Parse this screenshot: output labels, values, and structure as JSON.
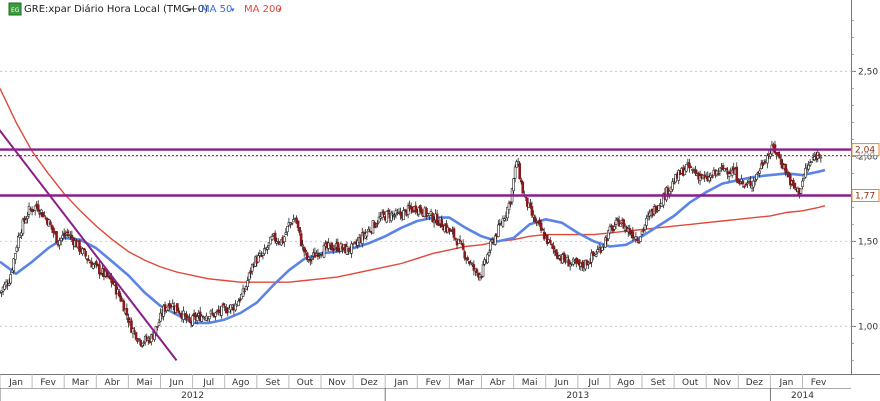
{
  "legend": {
    "symbol_label": "GRE:xpar Diário Hora Local (TMG+0)",
    "ma50_label": "MA 50",
    "ma200_label": "MA 200"
  },
  "colors": {
    "background": "#ffffff",
    "up_candle": "#ffffff",
    "down_candle": "#8b1a1a",
    "wick": "#222222",
    "ma50": "#5b84e6",
    "ma200": "#e0483a",
    "purple": "#8a1f8a",
    "dotted_red": "#d02020",
    "grid": "#c9c9c9",
    "price_badge_border": "#e08a2a"
  },
  "chart_data": {
    "type": "candlestick",
    "title": "GRE:xpar Diário Hora Local (TMG+0)",
    "y_ticks": [
      "1,00",
      "1,50",
      "2,00",
      "2,50"
    ],
    "ylim": [
      0.72,
      2.92
    ],
    "x_months": [
      {
        "label": "Jan",
        "t": 0
      },
      {
        "label": "Fev",
        "t": 1
      },
      {
        "label": "Mar",
        "t": 2
      },
      {
        "label": "Abr",
        "t": 3
      },
      {
        "label": "Mai",
        "t": 4
      },
      {
        "label": "Jun",
        "t": 5
      },
      {
        "label": "Jul",
        "t": 6
      },
      {
        "label": "Ago",
        "t": 7
      },
      {
        "label": "Set",
        "t": 8
      },
      {
        "label": "Out",
        "t": 9
      },
      {
        "label": "Nov",
        "t": 10
      },
      {
        "label": "Dez",
        "t": 11
      },
      {
        "label": "Jan",
        "t": 12
      },
      {
        "label": "Fev",
        "t": 13
      },
      {
        "label": "Mar",
        "t": 14
      },
      {
        "label": "Abr",
        "t": 15
      },
      {
        "label": "Mai",
        "t": 16
      },
      {
        "label": "Jun",
        "t": 17
      },
      {
        "label": "Jul",
        "t": 18
      },
      {
        "label": "Ago",
        "t": 19
      },
      {
        "label": "Set",
        "t": 20
      },
      {
        "label": "Out",
        "t": 21
      },
      {
        "label": "Nov",
        "t": 22
      },
      {
        "label": "Dez",
        "t": 23
      },
      {
        "label": "Jan",
        "t": 24
      },
      {
        "label": "Fev",
        "t": 25
      }
    ],
    "years": [
      {
        "label": "2012",
        "start": 0,
        "end": 12
      },
      {
        "label": "2013",
        "start": 12,
        "end": 24
      },
      {
        "label": "2014",
        "start": 24,
        "end": 26
      }
    ],
    "price_anchors": [
      [
        0.0,
        1.2
      ],
      [
        0.3,
        1.28
      ],
      [
        0.6,
        1.55
      ],
      [
        0.9,
        1.68
      ],
      [
        1.15,
        1.71
      ],
      [
        1.5,
        1.62
      ],
      [
        1.8,
        1.5
      ],
      [
        2.1,
        1.55
      ],
      [
        2.4,
        1.48
      ],
      [
        2.8,
        1.38
      ],
      [
        3.1,
        1.33
      ],
      [
        3.5,
        1.26
      ],
      [
        3.8,
        1.15
      ],
      [
        4.1,
        0.99
      ],
      [
        4.4,
        0.91
      ],
      [
        4.7,
        0.93
      ],
      [
        4.9,
        1.0
      ],
      [
        5.1,
        1.1
      ],
      [
        5.3,
        1.14
      ],
      [
        5.6,
        1.09
      ],
      [
        5.9,
        1.02
      ],
      [
        6.1,
        1.05
      ],
      [
        6.4,
        1.07
      ],
      [
        6.7,
        1.07
      ],
      [
        7.0,
        1.1
      ],
      [
        7.3,
        1.12
      ],
      [
        7.6,
        1.2
      ],
      [
        7.9,
        1.38
      ],
      [
        8.2,
        1.42
      ],
      [
        8.5,
        1.52
      ],
      [
        8.8,
        1.5
      ],
      [
        9.0,
        1.6
      ],
      [
        9.2,
        1.64
      ],
      [
        9.4,
        1.48
      ],
      [
        9.6,
        1.38
      ],
      [
        9.9,
        1.44
      ],
      [
        10.2,
        1.46
      ],
      [
        10.5,
        1.47
      ],
      [
        10.8,
        1.45
      ],
      [
        11.0,
        1.46
      ],
      [
        11.2,
        1.51
      ],
      [
        11.5,
        1.57
      ],
      [
        11.8,
        1.63
      ],
      [
        12.1,
        1.66
      ],
      [
        12.4,
        1.65
      ],
      [
        12.7,
        1.68
      ],
      [
        13.0,
        1.7
      ],
      [
        13.3,
        1.66
      ],
      [
        13.6,
        1.63
      ],
      [
        13.9,
        1.58
      ],
      [
        14.2,
        1.52
      ],
      [
        14.5,
        1.42
      ],
      [
        14.8,
        1.32
      ],
      [
        15.0,
        1.31
      ],
      [
        15.3,
        1.48
      ],
      [
        15.6,
        1.6
      ],
      [
        15.9,
        1.74
      ],
      [
        16.1,
        1.98
      ],
      [
        16.3,
        1.78
      ],
      [
        16.6,
        1.64
      ],
      [
        16.9,
        1.55
      ],
      [
        17.2,
        1.46
      ],
      [
        17.5,
        1.4
      ],
      [
        17.8,
        1.37
      ],
      [
        18.1,
        1.35
      ],
      [
        18.4,
        1.4
      ],
      [
        18.7,
        1.46
      ],
      [
        19.0,
        1.56
      ],
      [
        19.3,
        1.62
      ],
      [
        19.6,
        1.56
      ],
      [
        19.9,
        1.52
      ],
      [
        20.2,
        1.64
      ],
      [
        20.5,
        1.72
      ],
      [
        20.8,
        1.8
      ],
      [
        21.1,
        1.88
      ],
      [
        21.4,
        1.94
      ],
      [
        21.7,
        1.9
      ],
      [
        22.0,
        1.86
      ],
      [
        22.3,
        1.9
      ],
      [
        22.6,
        1.93
      ],
      [
        22.9,
        1.9
      ],
      [
        23.2,
        1.82
      ],
      [
        23.5,
        1.86
      ],
      [
        23.8,
        1.98
      ],
      [
        24.1,
        2.05
      ],
      [
        24.4,
        1.95
      ],
      [
        24.7,
        1.82
      ],
      [
        24.9,
        1.79
      ],
      [
        25.1,
        1.92
      ],
      [
        25.4,
        2.0
      ],
      [
        25.6,
        2.03
      ]
    ],
    "ma50": [
      [
        0.0,
        1.38
      ],
      [
        0.5,
        1.31
      ],
      [
        1.0,
        1.38
      ],
      [
        1.5,
        1.46
      ],
      [
        2.0,
        1.52
      ],
      [
        2.5,
        1.51
      ],
      [
        3.0,
        1.46
      ],
      [
        3.5,
        1.38
      ],
      [
        4.0,
        1.3
      ],
      [
        4.5,
        1.2
      ],
      [
        5.0,
        1.12
      ],
      [
        5.5,
        1.07
      ],
      [
        6.0,
        1.02
      ],
      [
        6.5,
        1.02
      ],
      [
        7.0,
        1.04
      ],
      [
        7.5,
        1.08
      ],
      [
        8.0,
        1.14
      ],
      [
        8.5,
        1.24
      ],
      [
        9.0,
        1.33
      ],
      [
        9.5,
        1.4
      ],
      [
        10.0,
        1.43
      ],
      [
        10.5,
        1.44
      ],
      [
        11.0,
        1.46
      ],
      [
        11.5,
        1.49
      ],
      [
        12.0,
        1.53
      ],
      [
        12.5,
        1.58
      ],
      [
        13.0,
        1.62
      ],
      [
        13.5,
        1.64
      ],
      [
        14.0,
        1.64
      ],
      [
        14.5,
        1.58
      ],
      [
        15.0,
        1.53
      ],
      [
        15.5,
        1.5
      ],
      [
        16.0,
        1.52
      ],
      [
        16.5,
        1.6
      ],
      [
        17.0,
        1.63
      ],
      [
        17.5,
        1.61
      ],
      [
        18.0,
        1.55
      ],
      [
        18.5,
        1.5
      ],
      [
        19.0,
        1.47
      ],
      [
        19.5,
        1.48
      ],
      [
        20.0,
        1.53
      ],
      [
        20.5,
        1.59
      ],
      [
        21.0,
        1.65
      ],
      [
        21.5,
        1.73
      ],
      [
        22.0,
        1.79
      ],
      [
        22.5,
        1.84
      ],
      [
        23.0,
        1.86
      ],
      [
        23.5,
        1.88
      ],
      [
        24.0,
        1.89
      ],
      [
        24.5,
        1.9
      ],
      [
        25.0,
        1.89
      ],
      [
        25.5,
        1.91
      ],
      [
        25.7,
        1.92
      ]
    ],
    "ma200": [
      [
        0.0,
        2.4
      ],
      [
        0.5,
        2.2
      ],
      [
        1.0,
        2.03
      ],
      [
        1.5,
        1.9
      ],
      [
        2.0,
        1.78
      ],
      [
        2.5,
        1.68
      ],
      [
        3.0,
        1.59
      ],
      [
        3.5,
        1.51
      ],
      [
        4.0,
        1.44
      ],
      [
        4.5,
        1.39
      ],
      [
        5.0,
        1.35
      ],
      [
        5.5,
        1.32
      ],
      [
        6.0,
        1.3
      ],
      [
        6.5,
        1.28
      ],
      [
        7.0,
        1.27
      ],
      [
        7.5,
        1.26
      ],
      [
        8.0,
        1.26
      ],
      [
        8.5,
        1.26
      ],
      [
        9.0,
        1.26
      ],
      [
        9.5,
        1.27
      ],
      [
        10.0,
        1.28
      ],
      [
        10.5,
        1.29
      ],
      [
        11.0,
        1.31
      ],
      [
        11.5,
        1.33
      ],
      [
        12.0,
        1.35
      ],
      [
        12.5,
        1.37
      ],
      [
        13.0,
        1.4
      ],
      [
        13.5,
        1.43
      ],
      [
        14.0,
        1.45
      ],
      [
        14.5,
        1.47
      ],
      [
        15.0,
        1.48
      ],
      [
        15.5,
        1.5
      ],
      [
        16.0,
        1.51
      ],
      [
        16.5,
        1.53
      ],
      [
        17.0,
        1.54
      ],
      [
        17.5,
        1.54
      ],
      [
        18.0,
        1.54
      ],
      [
        18.5,
        1.54
      ],
      [
        19.0,
        1.55
      ],
      [
        19.5,
        1.56
      ],
      [
        20.0,
        1.57
      ],
      [
        20.5,
        1.58
      ],
      [
        21.0,
        1.59
      ],
      [
        21.5,
        1.6
      ],
      [
        22.0,
        1.61
      ],
      [
        22.5,
        1.62
      ],
      [
        23.0,
        1.63
      ],
      [
        23.5,
        1.64
      ],
      [
        24.0,
        1.65
      ],
      [
        24.5,
        1.67
      ],
      [
        25.0,
        1.68
      ],
      [
        25.5,
        1.7
      ],
      [
        25.7,
        1.71
      ]
    ],
    "horizontal_lines": [
      {
        "value": 2.04,
        "label": "2,04",
        "style": "solid"
      },
      {
        "value": 1.77,
        "label": "1,77",
        "style": "solid"
      },
      {
        "value": 2.005,
        "label": "2,00",
        "style": "dotted"
      }
    ],
    "trendline": {
      "from": [
        -0.2,
        2.2
      ],
      "to": [
        5.5,
        0.8
      ]
    }
  }
}
